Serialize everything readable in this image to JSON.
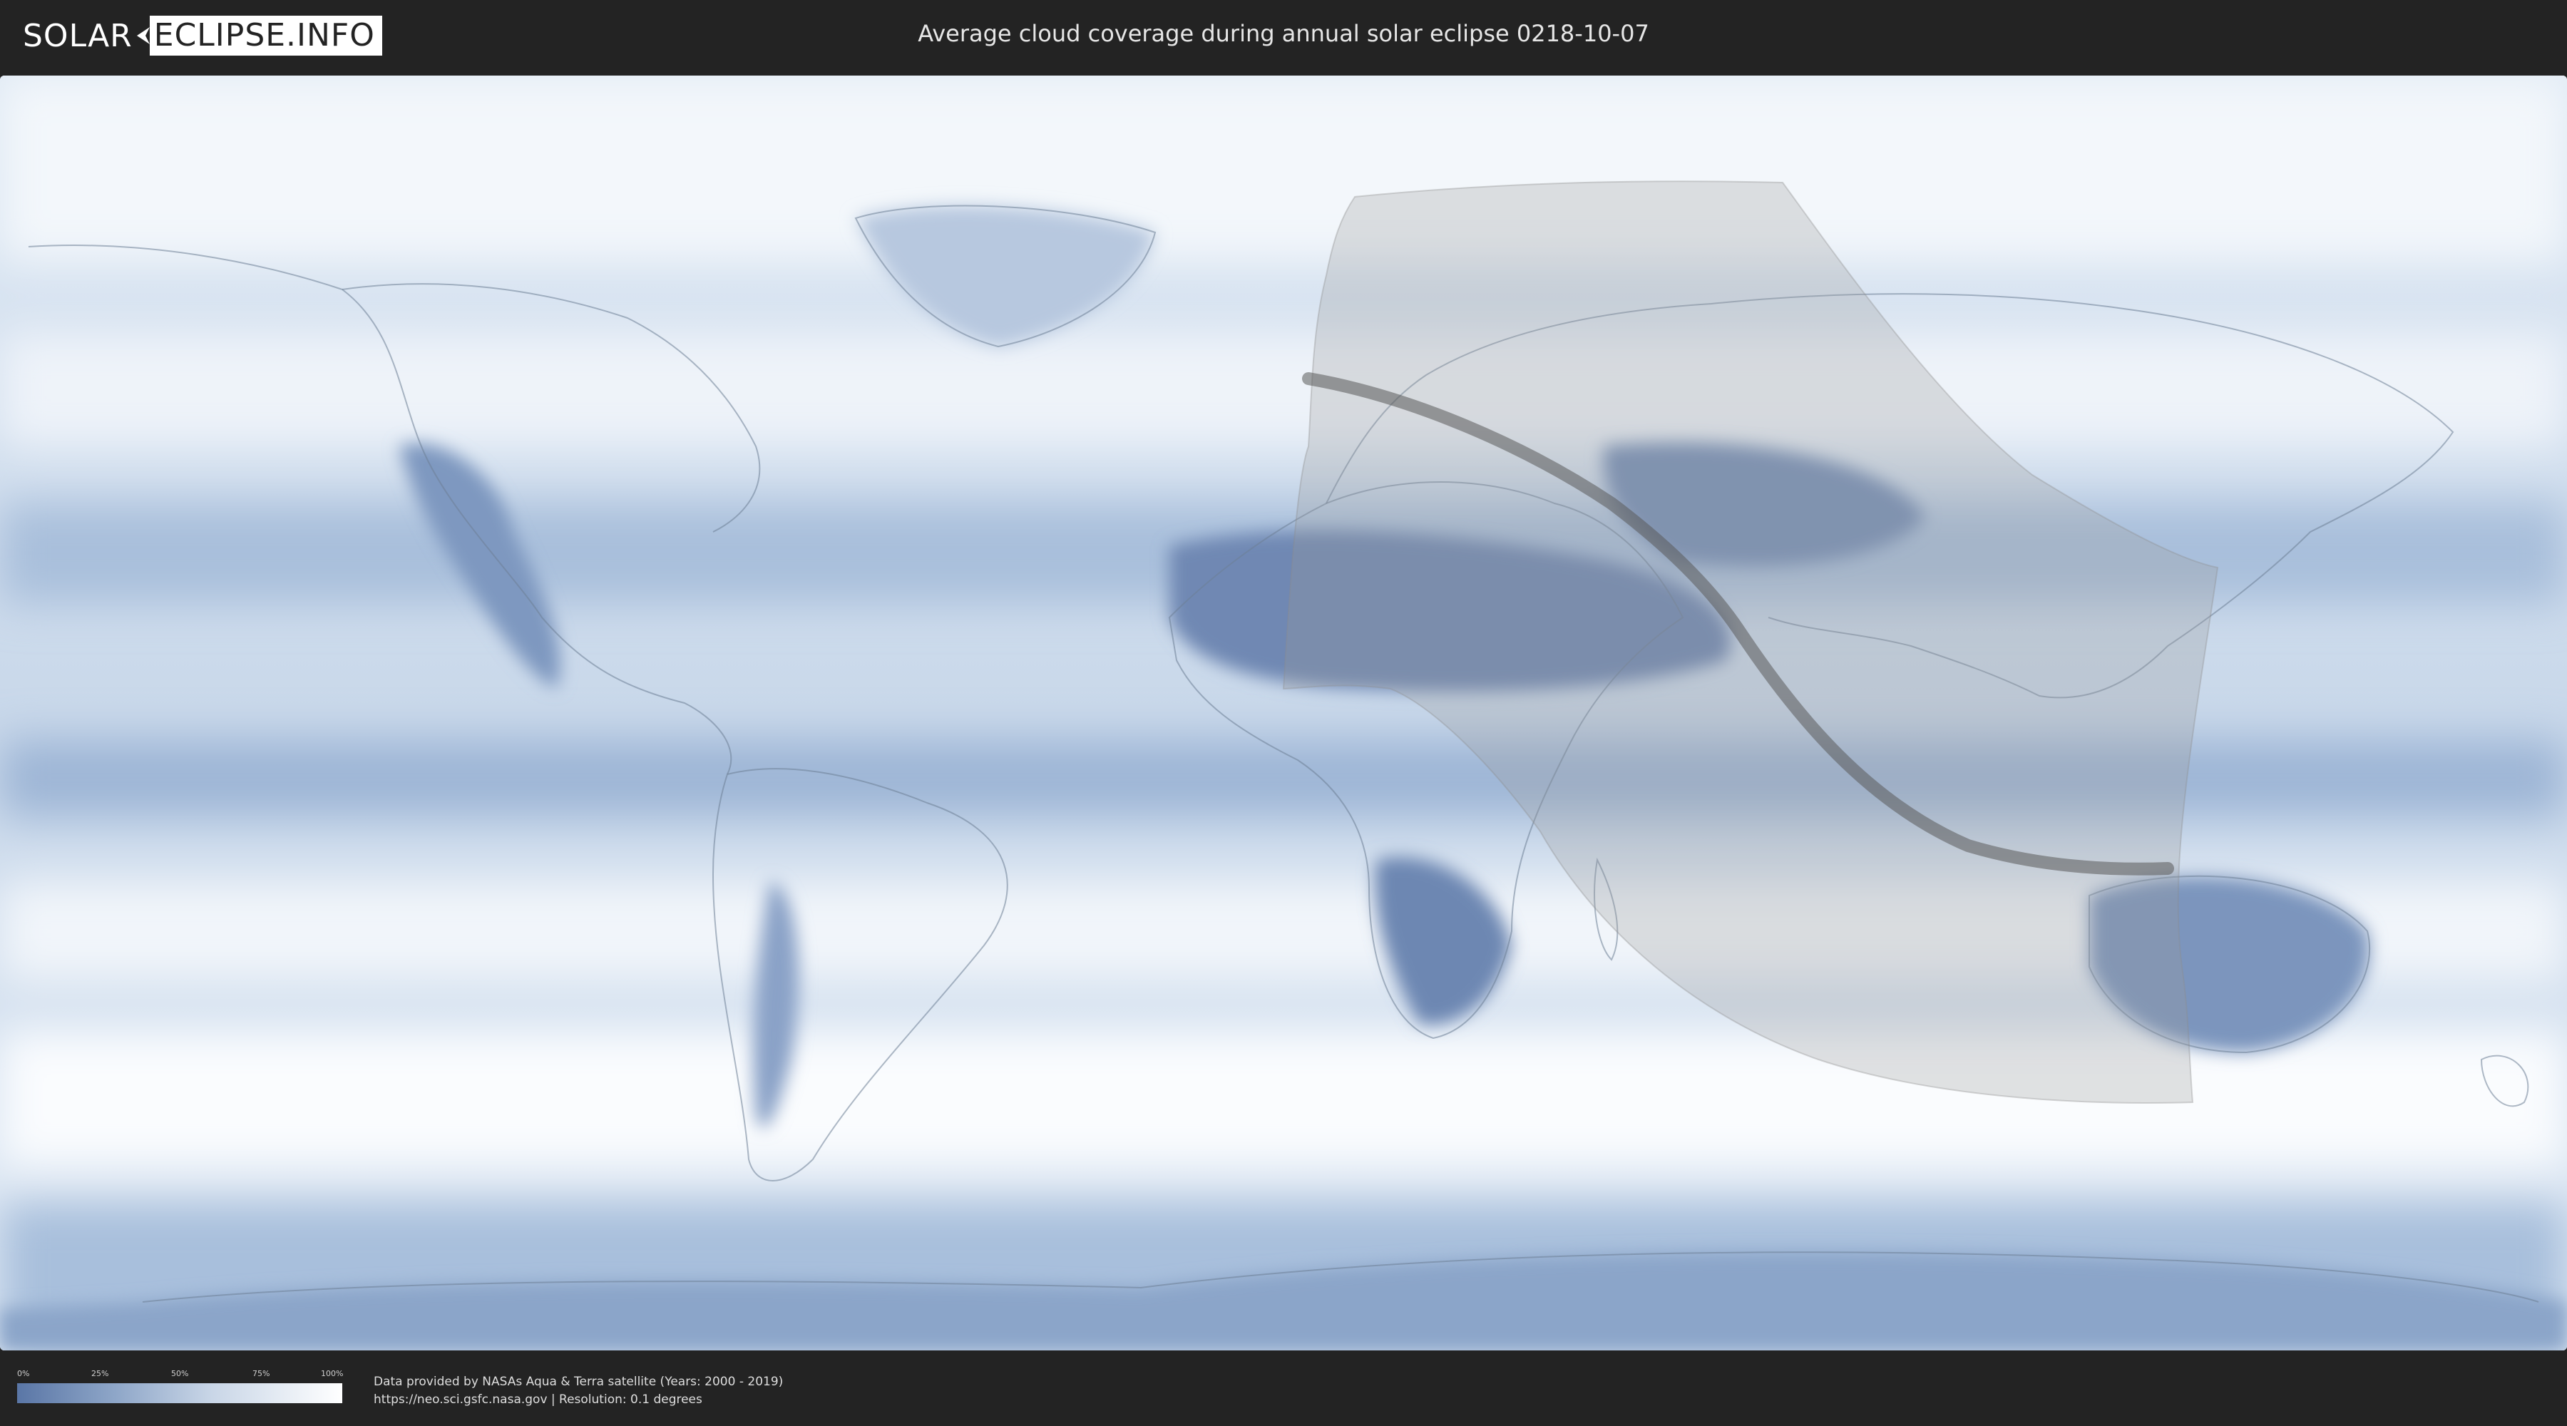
{
  "header": {
    "logo_part1": "SOLAR",
    "logo_part2": "ECLIPSE.INFO",
    "title": "Average cloud coverage during annual solar eclipse 0218-10-07"
  },
  "legend": {
    "ticks": [
      "0%",
      "25%",
      "50%",
      "75%",
      "100%"
    ],
    "colors": {
      "low": "#5a76a6",
      "high": "#ffffff"
    }
  },
  "footer": {
    "credit_line": "Data provided by NASAs Aqua & Terra satellite (Years: 2000 - 2019)",
    "source_line": "https://neo.sci.gsfc.nasa.gov | Resolution: 0.1 degrees"
  },
  "map": {
    "base_color": "#e9f0f8",
    "cloudy_color": "#ffffff",
    "clear_color": "#5a76a6",
    "shadow_color": "#8a8a8a",
    "path_color": "#555555"
  }
}
